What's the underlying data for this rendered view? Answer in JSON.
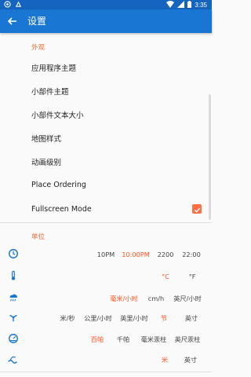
{
  "status_bar": {
    "time": "3:35"
  },
  "app_bar": {
    "title": "设置"
  },
  "appearance": {
    "header": "外观",
    "items": [
      {
        "label": "应用程序主题"
      },
      {
        "label": "小部件主题"
      },
      {
        "label": "小部件文本大小"
      },
      {
        "label": "地图样式"
      },
      {
        "label": "动画级别"
      },
      {
        "label": "Place Ordering"
      },
      {
        "label": "Fullscreen Mode",
        "checked": true
      }
    ]
  },
  "units": {
    "header": "单位",
    "rows": [
      {
        "icon": "clock-icon",
        "options": [
          "10PM",
          "10:00PM",
          "2200",
          "22:00"
        ],
        "selected": 1
      },
      {
        "icon": "thermometer-icon",
        "options": [
          "°C",
          "°F"
        ],
        "selected": 0
      },
      {
        "icon": "rain-icon",
        "options": [
          "毫米/小时",
          "cm/h",
          "英尺/小时"
        ],
        "selected": 0
      },
      {
        "icon": "wind-icon",
        "options": [
          "米/秒",
          "公里/小时",
          "英里/小时",
          "节",
          "英寸"
        ],
        "selected": 3
      },
      {
        "icon": "pressure-gauge-icon",
        "options": [
          "百帕",
          "千帕",
          "毫米汞柱",
          "英尺汞柱"
        ],
        "selected": 0
      },
      {
        "icon": "wave-icon",
        "options": [
          "米",
          "英寸"
        ],
        "selected": 0
      }
    ]
  },
  "colors": {
    "primary": "#1976d2",
    "status_bar": "#1565c0",
    "accent": "#ff5722"
  }
}
